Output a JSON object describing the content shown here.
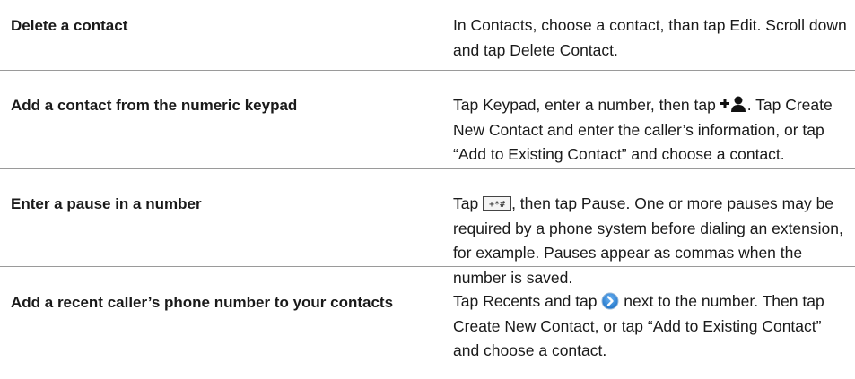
{
  "rows": [
    {
      "task": "Delete a contact",
      "desc": "In Contacts, choose a contact, than tap Edit. Scroll down and tap Delete Contact."
    },
    {
      "task": "Add a contact from the numeric keypad",
      "desc_before": "Tap Keypad, enter a number, then tap ",
      "desc_icon": "add-contact-icon",
      "desc_after": ". Tap Create New Contact and enter the caller’s information, or tap “Add to Existing Contact” and choose a contact."
    },
    {
      "task": "Enter a pause in a number",
      "desc_before": "Tap ",
      "desc_icon": "keypad-key-icon",
      "desc_after": ", then tap Pause. One or more pauses may be required by a phone system before dialing an extension, for example. Pauses appear as commas when the number is saved."
    },
    {
      "task": "Add a recent caller’s phone number to your contacts",
      "desc_before": "Tap Recents and tap ",
      "desc_icon": "arrow-circle-icon",
      "desc_after": " next to the number. Then tap Create New Contact, or tap “Add to Existing Contact” and choose a contact."
    }
  ],
  "colors": {
    "text": "#1a1a1a",
    "divider": "#9a9a9a",
    "arrow_blue": "#1e73c8"
  }
}
